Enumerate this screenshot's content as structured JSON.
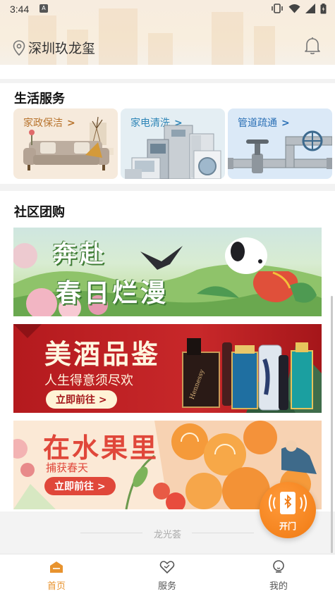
{
  "status_bar": {
    "time": "3:44",
    "notification_glyph": "A"
  },
  "header": {
    "location": "深圳玖龙玺"
  },
  "services": {
    "title": "生活服务",
    "cards": [
      {
        "label": "家政保洁",
        "color": "#b8742e",
        "bg": "#f7ebdc",
        "icon": "sofa-illustration"
      },
      {
        "label": "家电清洗",
        "color": "#2f86b7",
        "bg": "#e3eef4",
        "icon": "appliances-illustration"
      },
      {
        "label": "管道疏通",
        "color": "#2a6fb5",
        "bg": "#d8e8f8",
        "icon": "pipe-valve-illustration"
      }
    ],
    "chevron": ">"
  },
  "group_buy": {
    "title": "社区团购",
    "banners": [
      {
        "line1": "奔赴",
        "line2": "春日烂漫"
      },
      {
        "title": "美酒品鉴",
        "subtitle": "人生得意须尽欢",
        "button": "立即前往 >",
        "brand_text": "Hennessy"
      },
      {
        "title": "在水果里",
        "subtitle": "捕获春天",
        "button": "立即前往 >"
      }
    ]
  },
  "footer": {
    "text": "龙光荟"
  },
  "fab": {
    "label": "开门"
  },
  "tabs": [
    {
      "label": "首页",
      "active": true
    },
    {
      "label": "服务",
      "active": false
    },
    {
      "label": "我的",
      "active": false
    }
  ],
  "colors": {
    "accent": "#f0841c",
    "tab_active": "#e8932e",
    "tab_inactive": "#555555"
  }
}
